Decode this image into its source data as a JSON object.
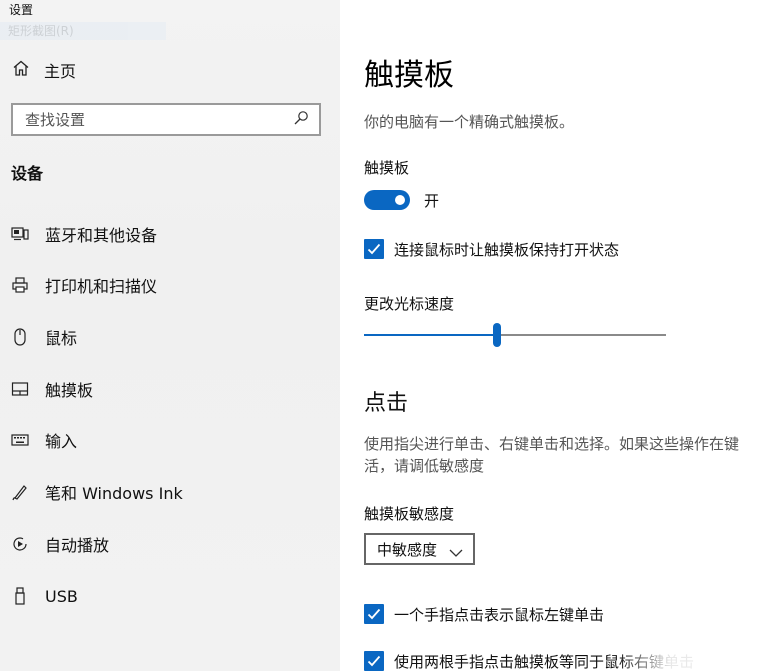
{
  "window": {
    "title": "设置",
    "ghost_text": "矩形截图(R)"
  },
  "sidebar": {
    "home_label": "主页",
    "search_placeholder": "查找设置",
    "section_title": "设备",
    "items": [
      {
        "label": "蓝牙和其他设备",
        "icon": "bluetooth-devices-icon"
      },
      {
        "label": "打印机和扫描仪",
        "icon": "printer-icon"
      },
      {
        "label": "鼠标",
        "icon": "mouse-icon"
      },
      {
        "label": "触摸板",
        "icon": "touchpad-icon"
      },
      {
        "label": "输入",
        "icon": "keyboard-icon"
      },
      {
        "label": "笔和 Windows Ink",
        "icon": "pen-icon"
      },
      {
        "label": "自动播放",
        "icon": "autoplay-icon"
      },
      {
        "label": "USB",
        "icon": "usb-icon"
      }
    ]
  },
  "main": {
    "title": "触摸板",
    "description": "你的电脑有一个精确式触摸板。",
    "touchpad_label": "触摸板",
    "toggle_state": "开",
    "toggle_on": true,
    "keep_on_with_mouse": {
      "label": "连接鼠标时让触摸板保持打开状态",
      "checked": true
    },
    "cursor_speed_label": "更改光标速度",
    "cursor_speed_fraction": 0.44,
    "tap_heading": "点击",
    "tap_description_line1": "使用指尖进行单击、右键单击和选择。如果这些操作在键",
    "tap_description_line2": "活，请调低敏感度",
    "sensitivity_label": "触摸板敏感度",
    "sensitivity_value": "中敏感度",
    "option_single_tap": {
      "label": "一个手指点击表示鼠标左键单击",
      "checked": true
    },
    "option_two_finger": {
      "label": "使用两根手指点击触摸板等同于鼠标右键单击",
      "checked": true
    }
  },
  "colors": {
    "accent": "#0a67c2",
    "sidebar_bg": "#f2f2f2"
  }
}
